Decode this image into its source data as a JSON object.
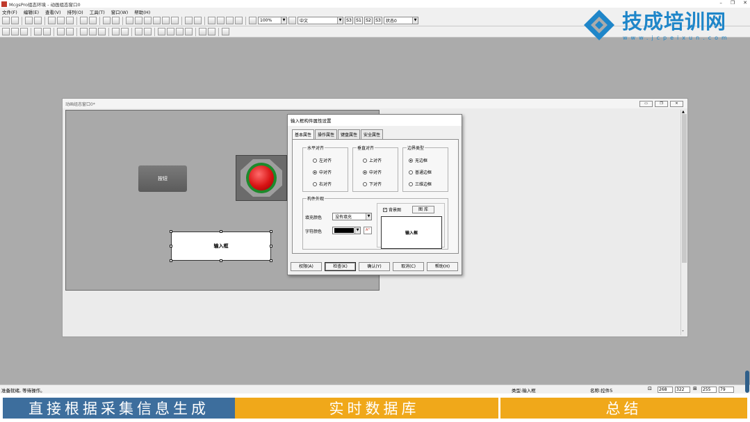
{
  "window": {
    "title": "McgsPro组态环境 - 动画组态窗口0"
  },
  "menu": [
    "文件(F)",
    "编辑(E)",
    "查看(V)",
    "排列(O)",
    "工具(T)",
    "窗口(W)",
    "帮助(H)"
  ],
  "toolbar": {
    "zoom": "100%",
    "language": "中文",
    "state_buttons": [
      "S3",
      "S1",
      "S2",
      "S3"
    ],
    "state_select": "状态0"
  },
  "watermark": {
    "brand": "技成培训网",
    "url": "www.jcpeixun.com"
  },
  "mdi": {
    "title": "动画组态窗口0*"
  },
  "canvas": {
    "button_label": "按钮",
    "input_label": "输入框"
  },
  "dialog": {
    "title": "输入框构件属性设置",
    "tabs": [
      "基本属性",
      "操作属性",
      "键盘属性",
      "安全属性"
    ],
    "halign": {
      "label": "水平对齐",
      "options": [
        "左对齐",
        "中对齐",
        "右对齐"
      ],
      "selected": 1
    },
    "valign": {
      "label": "垂直对齐",
      "options": [
        "上对齐",
        "中对齐",
        "下对齐"
      ],
      "selected": 1
    },
    "border": {
      "label": "边界类型",
      "options": [
        "无边框",
        "普通边框",
        "三维边框"
      ],
      "selected": 0
    },
    "appearance": {
      "label": "构件外观",
      "fill_label": "填充颜色",
      "fill_value": "没有填充",
      "text_color_label": "字符颜色",
      "text_color": "#000000",
      "bg_image_label": "背景图",
      "bg_image_checked": true,
      "library_button": "图  库",
      "preview_text": "输入框"
    },
    "buttons": [
      "权限(A)",
      "检查(K)",
      "确认(Y)",
      "取消(C)",
      "帮助(H)"
    ]
  },
  "status": {
    "message": "准备就绪, 等待操作。",
    "type": "类型:输入框",
    "name": "名称:控件5",
    "coords": [
      "268",
      "322",
      "255",
      "79"
    ]
  },
  "banners": [
    "直接根据采集信息生成",
    "实时数据库",
    "总结"
  ]
}
